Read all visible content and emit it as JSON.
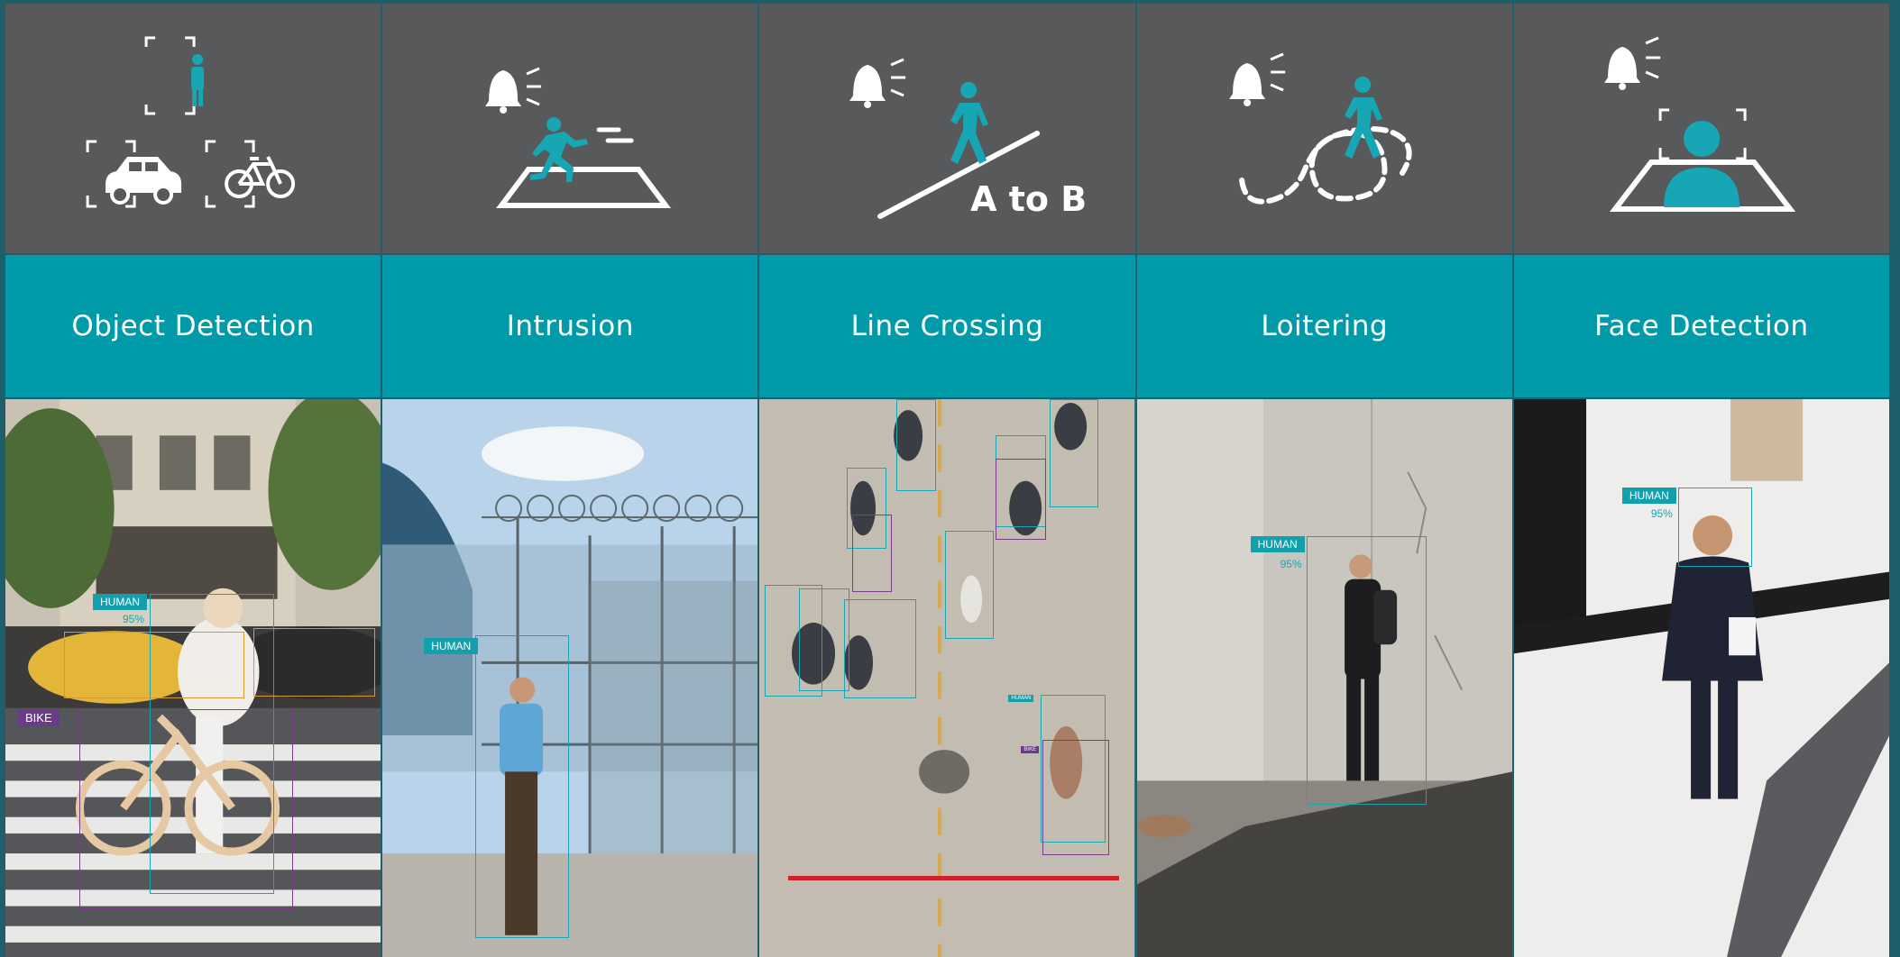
{
  "features": [
    {
      "id": "object-detection",
      "label": "Object Detection"
    },
    {
      "id": "intrusion",
      "label": "Intrusion"
    },
    {
      "id": "line-crossing",
      "label": "Line Crossing",
      "icon_text": "A to B"
    },
    {
      "id": "loitering",
      "label": "Loitering"
    },
    {
      "id": "face-detection",
      "label": "Face Detection"
    }
  ],
  "detections": {
    "human_tag": "HUMAN",
    "bike_tag": "BIKE",
    "confidence": "95%"
  },
  "colors": {
    "teal": "#009aa8",
    "icon_bg": "#58595b",
    "bike_purple": "#6b3a8c",
    "vehicle_orange": "#d39b2d",
    "line_red": "#d0222b"
  },
  "icons": [
    "person-icon",
    "car-icon",
    "bicycle-icon",
    "bell-icon",
    "running-person-icon",
    "walking-person-icon",
    "face-icon"
  ]
}
